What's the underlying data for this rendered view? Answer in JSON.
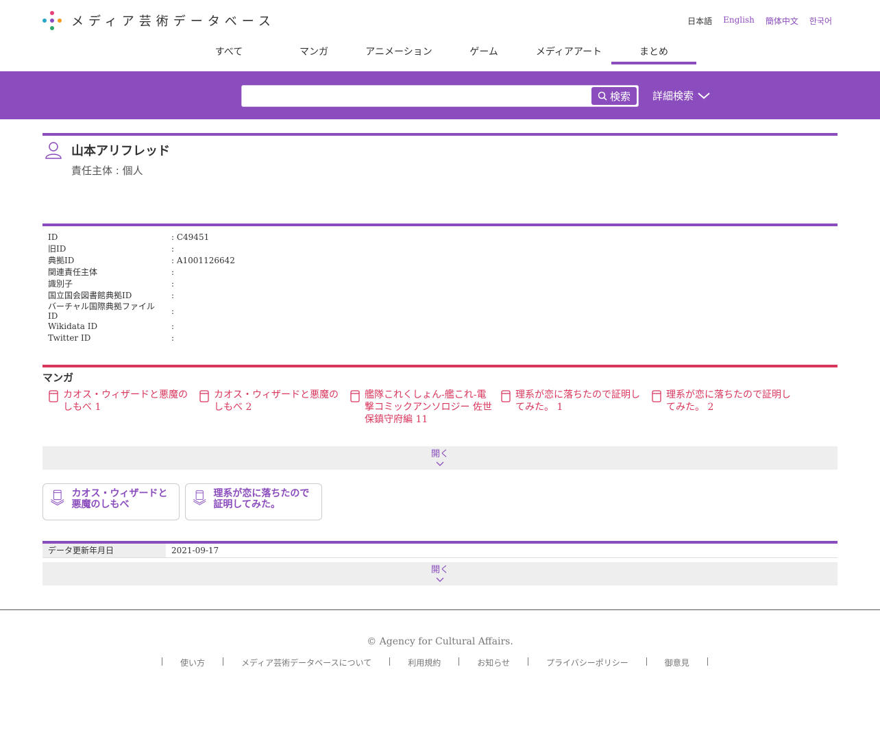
{
  "logo": {
    "text": "メディア芸術データベース"
  },
  "languages": [
    "日本語",
    "English",
    "簡体中文",
    "한국어"
  ],
  "nav": [
    "すべて",
    "マンガ",
    "アニメーション",
    "ゲーム",
    "メディアアート",
    "まとめ"
  ],
  "search": {
    "value": "",
    "button_label": "検索",
    "advanced_label": "詳細検索"
  },
  "person": {
    "name": "山本アリフレッド",
    "type": "責任主体 : 個人"
  },
  "info": [
    {
      "key": "ID",
      "value": ": C49451"
    },
    {
      "key": "旧ID",
      "value": ":"
    },
    {
      "key": "典拠ID",
      "value": ": A1001126642"
    },
    {
      "key": "関連責任主体",
      "value": ":"
    },
    {
      "key": "識別子",
      "value": ":"
    },
    {
      "key": "国立国会図書館典拠ID",
      "value": ":"
    },
    {
      "key": "バーチャル国際典拠ファイルID",
      "value": ":"
    },
    {
      "key": "Wikidata ID",
      "value": ":"
    },
    {
      "key": "Twitter ID",
      "value": ":"
    }
  ],
  "manga": {
    "title": "マンガ",
    "items": [
      "カオス・ウィザードと悪魔のしもべ 1",
      "カオス・ウィザードと悪魔のしもべ 2",
      "艦隊これくしょん-艦これ-電撃コミックアンソロジー 佐世保鎮守府編 11",
      "理系が恋に落ちたので証明してみた。 1",
      "理系が恋に落ちたので証明してみた。 2"
    ],
    "open_label": "開く"
  },
  "series": [
    "カオス・ウィザードと悪魔のしもべ",
    "理系が恋に落ちたので証明してみた。"
  ],
  "update": {
    "key": "データ更新年月日",
    "value": "2021-09-17",
    "open_label": "開く"
  },
  "footer": {
    "copyright": "© Agency for Cultural Affairs.",
    "links": [
      "使い方",
      "メディア芸術データベースについて",
      "利用規約",
      "お知らせ",
      "プライバシーポリシー",
      "御意見"
    ]
  },
  "colors": {
    "accent": "#8b4cbd",
    "manga": "#d9365c"
  }
}
